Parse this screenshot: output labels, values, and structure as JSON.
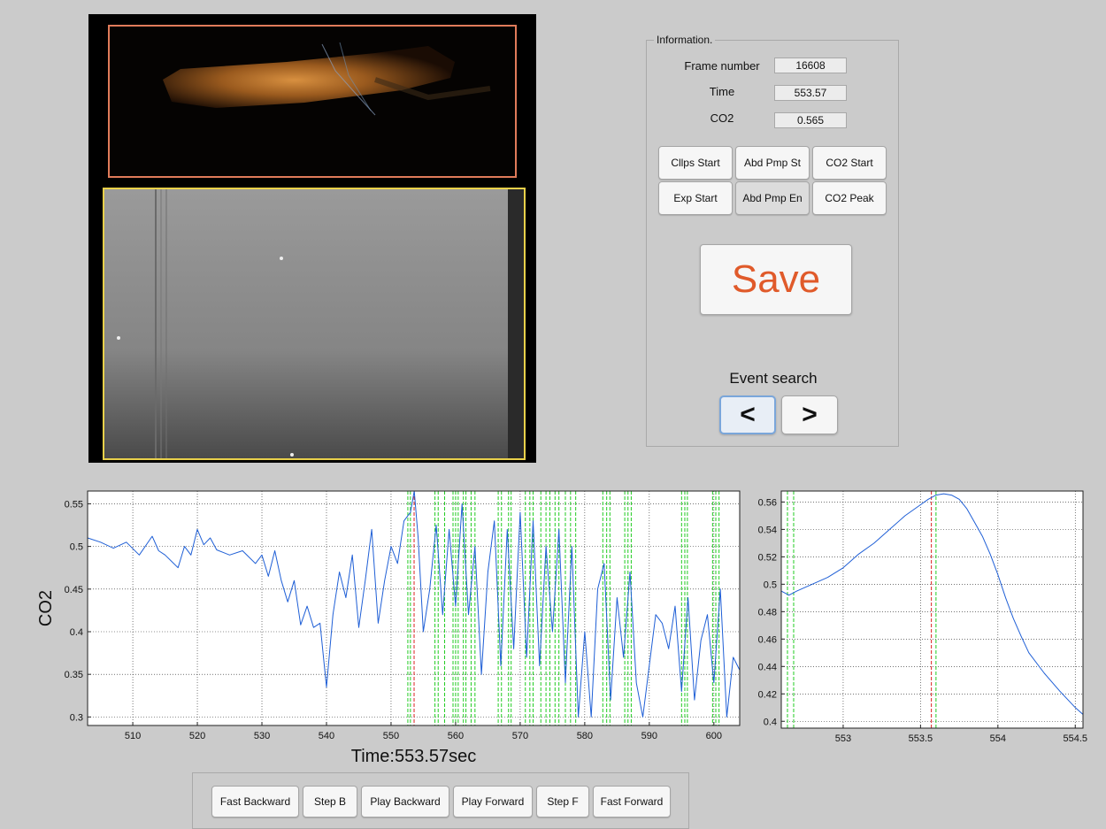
{
  "info": {
    "legend": "Information.",
    "frame_label": "Frame number",
    "frame_value": "16608",
    "time_label": "Time",
    "time_value": "553.57",
    "co2_label": "CO2",
    "co2_value": "0.565"
  },
  "markers": {
    "clips_start": "Cllps Start",
    "abd_pmp_start": "Abd Pmp St",
    "co2_start": "CO2 Start",
    "exp_start": "Exp Start",
    "abd_pmp_end": "Abd Pmp En",
    "co2_peak": "CO2 Peak"
  },
  "save_label": "Save",
  "event_search": {
    "label": "Event search",
    "prev": "<",
    "next": ">"
  },
  "playback": {
    "fast_backward": "Fast Backward",
    "step_b": "Step B",
    "play_backward": "Play Backward",
    "play_forward": "Play Forward",
    "step_f": "Step F",
    "fast_forward": "Fast Forward"
  },
  "colors": {
    "trace": "#1f5fd6",
    "event_line": "#22cc22",
    "cursor_line": "#dd2222",
    "top_frame_border": "#e07b5a",
    "bottom_frame_border": "#e8d04a",
    "save_text": "#e05a2a"
  },
  "chart_data": [
    {
      "type": "line",
      "title": "",
      "xlabel": "Time:553.57sec",
      "ylabel": "CO2",
      "xlim": [
        503,
        604
      ],
      "ylim": [
        0.29,
        0.565
      ],
      "x_ticks": [
        510,
        520,
        530,
        540,
        550,
        560,
        570,
        580,
        590,
        600
      ],
      "y_ticks": [
        0.3,
        0.35,
        0.4,
        0.45,
        0.5,
        0.55
      ],
      "y_tick_labels": [
        "0.3",
        "0.35",
        "0.4",
        "0.45",
        "0.5",
        "0.55"
      ],
      "grid": true,
      "cursor_x": 553.57,
      "event_lines": [
        552.6,
        553.0,
        556.8,
        557.3,
        558.3,
        559.6,
        560.0,
        560.4,
        561.2,
        561.6,
        562.4,
        563.0,
        566.6,
        567.1,
        568.2,
        568.6,
        570.8,
        571.5,
        572.0,
        573.2,
        574.0,
        574.6,
        575.4,
        576.0,
        577.0,
        577.8,
        578.6,
        582.8,
        583.4,
        583.9,
        586.2,
        586.7,
        587.2,
        595.0,
        595.5,
        595.9,
        599.8,
        600.3,
        600.8
      ],
      "series": [
        {
          "points": [
            [
              503,
              0.51
            ],
            [
              505,
              0.505
            ],
            [
              507,
              0.498
            ],
            [
              509,
              0.505
            ],
            [
              511,
              0.49
            ],
            [
              513,
              0.512
            ],
            [
              514,
              0.495
            ],
            [
              515,
              0.49
            ],
            [
              517,
              0.475
            ],
            [
              518,
              0.5
            ],
            [
              519,
              0.49
            ],
            [
              520,
              0.52
            ],
            [
              521,
              0.502
            ],
            [
              522,
              0.51
            ],
            [
              523,
              0.496
            ],
            [
              525,
              0.49
            ],
            [
              527,
              0.495
            ],
            [
              529,
              0.48
            ],
            [
              530,
              0.49
            ],
            [
              531,
              0.465
            ],
            [
              532,
              0.495
            ],
            [
              533,
              0.46
            ],
            [
              534,
              0.435
            ],
            [
              535,
              0.46
            ],
            [
              536,
              0.408
            ],
            [
              537,
              0.43
            ],
            [
              538,
              0.405
            ],
            [
              539,
              0.41
            ],
            [
              540,
              0.335
            ],
            [
              541,
              0.42
            ],
            [
              542,
              0.47
            ],
            [
              543,
              0.44
            ],
            [
              544,
              0.49
            ],
            [
              545,
              0.405
            ],
            [
              546,
              0.46
            ],
            [
              547,
              0.52
            ],
            [
              548,
              0.41
            ],
            [
              549,
              0.46
            ],
            [
              550,
              0.5
            ],
            [
              551,
              0.48
            ],
            [
              552,
              0.53
            ],
            [
              553,
              0.54
            ],
            [
              553.6,
              0.565
            ],
            [
              554.2,
              0.51
            ],
            [
              555,
              0.4
            ],
            [
              556,
              0.45
            ],
            [
              557,
              0.525
            ],
            [
              558,
              0.42
            ],
            [
              559,
              0.52
            ],
            [
              560,
              0.43
            ],
            [
              561,
              0.55
            ],
            [
              562,
              0.42
            ],
            [
              563,
              0.5
            ],
            [
              564,
              0.35
            ],
            [
              565,
              0.47
            ],
            [
              566,
              0.53
            ],
            [
              567,
              0.36
            ],
            [
              568,
              0.52
            ],
            [
              569,
              0.38
            ],
            [
              570,
              0.54
            ],
            [
              571,
              0.37
            ],
            [
              572,
              0.53
            ],
            [
              573,
              0.36
            ],
            [
              574,
              0.5
            ],
            [
              575,
              0.4
            ],
            [
              576,
              0.52
            ],
            [
              577,
              0.34
            ],
            [
              578,
              0.5
            ],
            [
              579,
              0.3
            ],
            [
              580,
              0.4
            ],
            [
              581,
              0.3
            ],
            [
              582,
              0.45
            ],
            [
              583,
              0.48
            ],
            [
              584,
              0.32
            ],
            [
              585,
              0.44
            ],
            [
              586,
              0.37
            ],
            [
              587,
              0.47
            ],
            [
              588,
              0.34
            ],
            [
              589,
              0.3
            ],
            [
              590,
              0.36
            ],
            [
              591,
              0.42
            ],
            [
              592,
              0.41
            ],
            [
              593,
              0.38
            ],
            [
              594,
              0.43
            ],
            [
              595,
              0.33
            ],
            [
              596,
              0.44
            ],
            [
              597,
              0.32
            ],
            [
              598,
              0.39
            ],
            [
              599,
              0.42
            ],
            [
              600,
              0.34
            ],
            [
              601,
              0.45
            ],
            [
              602,
              0.3
            ],
            [
              603,
              0.37
            ],
            [
              604,
              0.355
            ]
          ]
        }
      ]
    },
    {
      "type": "line",
      "title": "",
      "xlabel": "",
      "ylabel": "",
      "xlim": [
        552.6,
        554.55
      ],
      "ylim": [
        0.395,
        0.568
      ],
      "x_ticks": [
        553,
        553.5,
        554,
        554.5
      ],
      "y_ticks": [
        0.4,
        0.42,
        0.44,
        0.46,
        0.48,
        0.5,
        0.52,
        0.54,
        0.56
      ],
      "y_tick_labels": [
        "0.4",
        "0.42",
        "0.44",
        "0.46",
        "0.48",
        "0.5",
        "0.52",
        "0.54",
        "0.56"
      ],
      "grid": true,
      "cursor_x": 553.57,
      "event_lines": [
        552.64,
        552.68,
        553.6
      ],
      "series": [
        {
          "points": [
            [
              552.6,
              0.495
            ],
            [
              552.65,
              0.492
            ],
            [
              552.7,
              0.495
            ],
            [
              552.8,
              0.5
            ],
            [
              552.9,
              0.505
            ],
            [
              553.0,
              0.512
            ],
            [
              553.1,
              0.522
            ],
            [
              553.2,
              0.53
            ],
            [
              553.3,
              0.54
            ],
            [
              553.4,
              0.55
            ],
            [
              553.5,
              0.558
            ],
            [
              553.55,
              0.562
            ],
            [
              553.6,
              0.565
            ],
            [
              553.65,
              0.566
            ],
            [
              553.7,
              0.565
            ],
            [
              553.75,
              0.562
            ],
            [
              553.8,
              0.555
            ],
            [
              553.85,
              0.545
            ],
            [
              553.9,
              0.535
            ],
            [
              553.95,
              0.522
            ],
            [
              554.0,
              0.507
            ],
            [
              554.05,
              0.49
            ],
            [
              554.1,
              0.475
            ],
            [
              554.15,
              0.462
            ],
            [
              554.2,
              0.45
            ],
            [
              554.3,
              0.435
            ],
            [
              554.4,
              0.422
            ],
            [
              554.5,
              0.41
            ],
            [
              554.55,
              0.405
            ]
          ]
        }
      ]
    }
  ]
}
